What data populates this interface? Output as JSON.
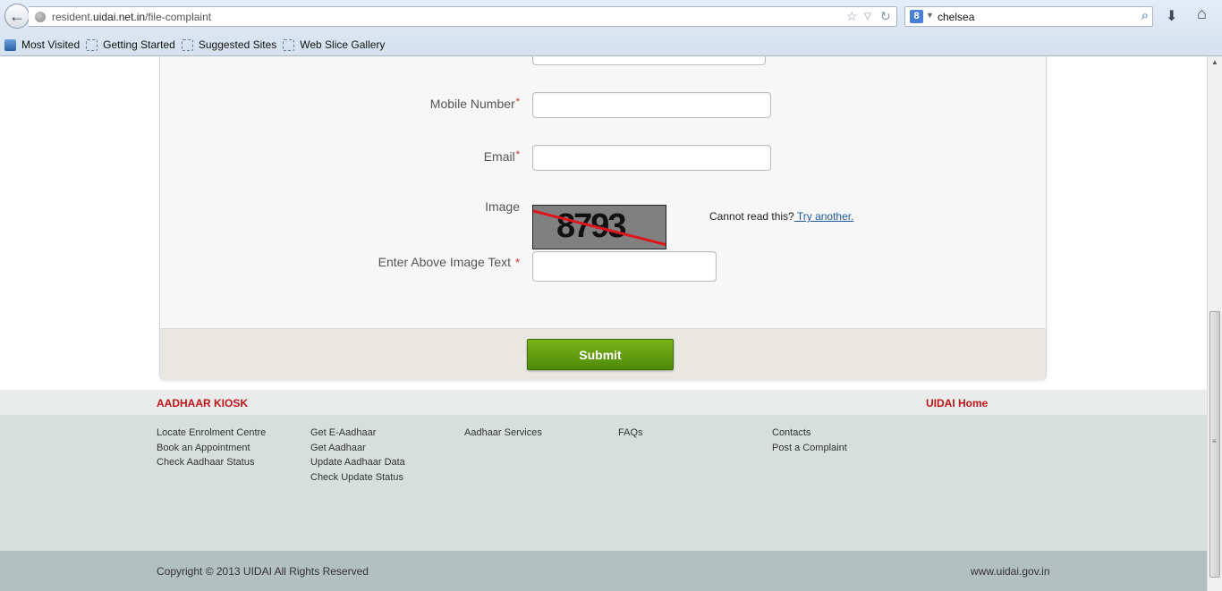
{
  "browser": {
    "url_prefix": "resident.",
    "url_domain": "uidai.net.in",
    "url_path": "/file-complaint",
    "search_engine_icon": "g-icon",
    "search_engine_letter": "8",
    "search_query": "chelsea",
    "bookmarks": [
      "Most Visited",
      "Getting Started",
      "Suggested Sites",
      "Web Slice Gallery"
    ]
  },
  "form": {
    "mobile_label": "Mobile Number",
    "email_label": "Email",
    "image_label": "Image",
    "captcha_text": "8793",
    "cannot_read": "Cannot read this?",
    "try_another": " Try another.",
    "enter_image_label": "Enter Above Image Text ",
    "required_mark": "*",
    "submit_label": "Submit"
  },
  "footer": {
    "kiosk_title": "AADHAAR KIOSK",
    "home_link": "UIDAI Home",
    "columns": [
      [
        "Locate Enrolment Centre",
        "Book an Appointment",
        "Check Aadhaar Status"
      ],
      [
        "Get E-Aadhaar",
        "Get Aadhaar",
        "Update Aadhaar Data",
        "Check Update Status"
      ],
      [
        "Aadhaar Services"
      ],
      [
        "FAQs"
      ],
      [
        "Contacts",
        "Post a Complaint"
      ]
    ],
    "copyright": "Copyright © 2013 UIDAI All Rights Reserved",
    "site_url": "www.uidai.gov.in"
  },
  "colors": {
    "accent_red": "#c0141a",
    "submit_green": "#5e9a0c",
    "link_blue": "#1f5a9e"
  }
}
